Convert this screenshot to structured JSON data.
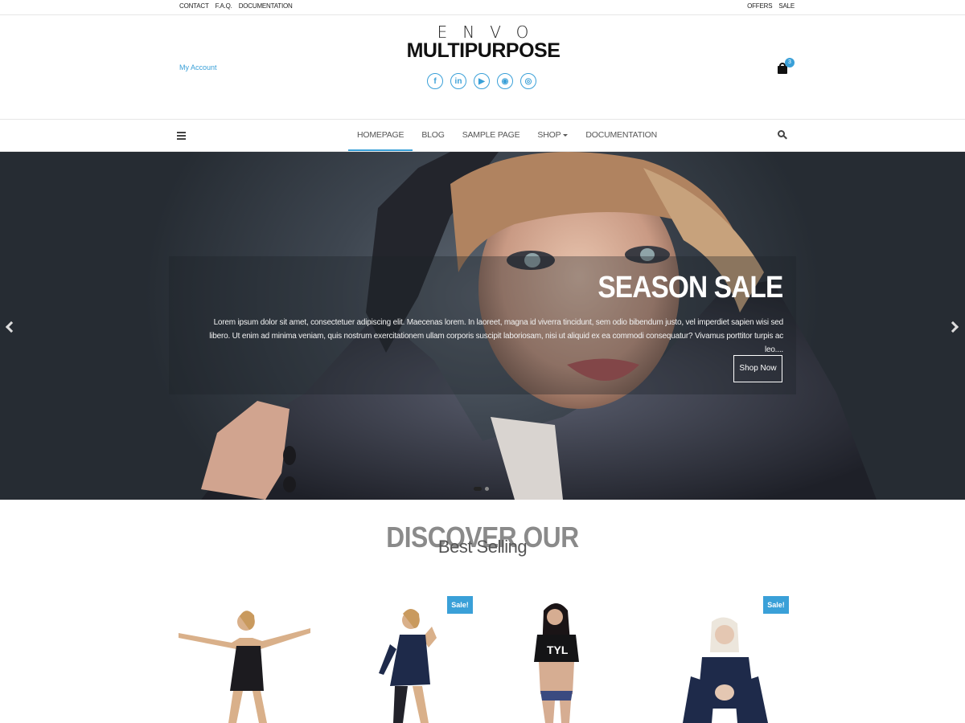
{
  "topbar": {
    "left_links": [
      "CONTACT",
      "F.A.Q.",
      "DOCUMENTATION"
    ],
    "right_links": [
      "OFFERS",
      "SALE"
    ]
  },
  "header": {
    "my_account": "My Account",
    "logo_top": "ENVO",
    "logo_bottom": "MULTIPURPOSE",
    "socials": [
      {
        "icon": "facebook-icon",
        "glyph": "f"
      },
      {
        "icon": "linkedin-icon",
        "glyph": "in"
      },
      {
        "icon": "youtube-icon",
        "glyph": "▶"
      },
      {
        "icon": "reddit-icon",
        "glyph": "◉"
      },
      {
        "icon": "instagram-icon",
        "glyph": "◎"
      }
    ],
    "cart_count": "3"
  },
  "nav": {
    "items": [
      "HOMEPAGE",
      "BLOG",
      "SAMPLE PAGE",
      "SHOP",
      "DOCUMENTATION"
    ],
    "active": "HOMEPAGE"
  },
  "hero": {
    "title": "SEASON SALE",
    "text": "Lorem ipsum dolor sit amet, consectetuer adipiscing elit. Maecenas lorem. In laoreet, magna id viverra tincidunt, sem odio bibendum justo, vel imperdiet sapien wisi sed libero. Ut enim ad minima veniam, quis nostrum exercitationem ullam corporis suscipit laboriosam, nisi ut aliquid ex ea commodi consequatur? Vivamus porttitor turpis ac leo....",
    "button": "Shop Now"
  },
  "discover": {
    "title": "DISCOVER OUR",
    "subtitle": "Best Selling"
  },
  "products": {
    "sale_label": "Sale!",
    "items": [
      {
        "sale": false
      },
      {
        "sale": true
      },
      {
        "sale": false
      },
      {
        "sale": true
      }
    ]
  },
  "colors": {
    "accent": "#3aa0d8",
    "hero_dark": "#262c33"
  }
}
